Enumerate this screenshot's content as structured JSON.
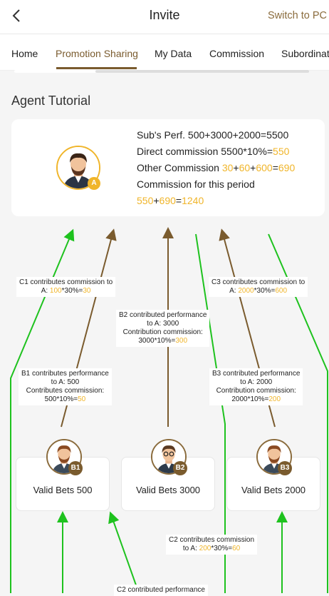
{
  "header": {
    "title": "Invite",
    "switch_label": "Switch to PC"
  },
  "tabs": [
    {
      "label": "Home"
    },
    {
      "label": "Promotion Sharing",
      "active": true
    },
    {
      "label": "My Data"
    },
    {
      "label": "Commission"
    },
    {
      "label": "Subordinat"
    }
  ],
  "section": {
    "title": "Agent Tutorial"
  },
  "summary": {
    "line1": "Sub's Perf. 500+3000+2000=5500",
    "line2_prefix": "Direct commission 5500*10%=",
    "line2_value": "550",
    "line3_prefix": "Other Commission ",
    "line3_a": "30",
    "line3_b": "60",
    "line3_c": "600",
    "line3_total": "690",
    "line4": "Commission for this period",
    "line5_a": "550",
    "line5_b": "690",
    "line5_total": "1240",
    "plus": "+",
    "equals": "=",
    "badge": "A"
  },
  "notes": {
    "c1_line1": "C1 contributes commission to",
    "c1_line2_prefix": "A: ",
    "c1_line2_value": "100",
    "c1_line2_mid": "*30%=",
    "c1_line2_result": "30",
    "b2_line1": "B2 contributed performance",
    "b2_line2": "to A: 3000",
    "b2_line3": "Contribution commission:",
    "b2_line4_prefix": "3000*10%=",
    "b2_line4_value": "300",
    "c3_line1": "C3 contributes commission to",
    "c3_line2_prefix": "A: ",
    "c3_line2_value": "2000",
    "c3_line2_mid": "*30%=",
    "c3_line2_result": "600",
    "b1_line1": "B1 contributes performance",
    "b1_line2": "to A: 500",
    "b1_line3": "Contributes commission:",
    "b1_line4_prefix": "500*10%=",
    "b1_line4_value": "50",
    "b3_line1": "B3 contributed performance",
    "b3_line2": "to A: 2000",
    "b3_line3": "Contribution commission:",
    "b3_line4_prefix": "2000*10%=",
    "b3_line4_value": "200",
    "c2_line1": "C2 contributes commission",
    "c2_line2_prefix": "to A: ",
    "c2_line2_value": "200",
    "c2_line2_mid": "*30%=",
    "c2_line2_result": "60",
    "c2b_line1": "C2 contributed performance"
  },
  "bets": [
    {
      "badge": "B1",
      "label": "Valid Bets 500"
    },
    {
      "badge": "B2",
      "label": "Valid Bets 3000"
    },
    {
      "badge": "B3",
      "label": "Valid Bets 2000"
    }
  ],
  "colors": {
    "accent_brown": "#7a5b2e",
    "highlight": "#f0b52a",
    "green_arrow": "#1ec21e",
    "brown_arrow": "#7a5b2e"
  },
  "icons": {
    "back": "chevron-left-icon",
    "avatar": "person-avatar-icon"
  }
}
